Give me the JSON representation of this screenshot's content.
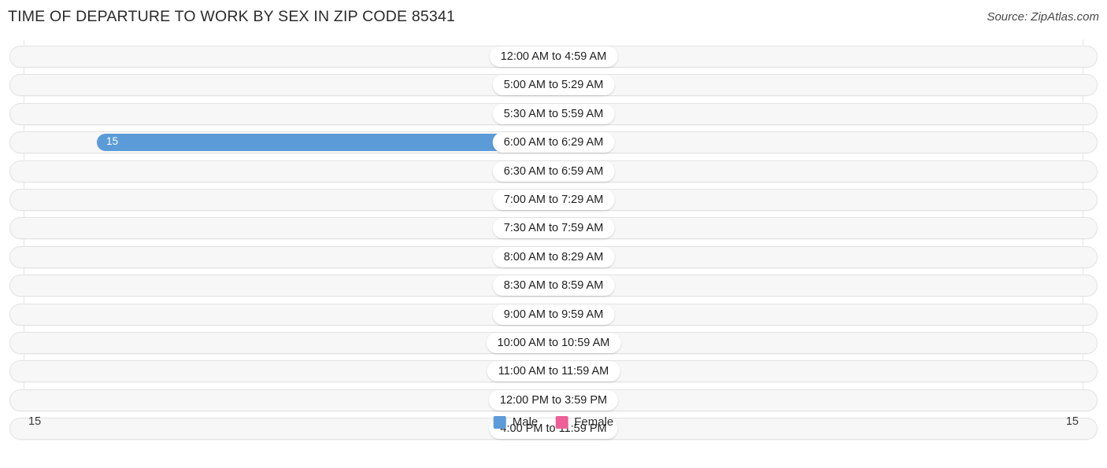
{
  "header": {
    "title": "TIME OF DEPARTURE TO WORK BY SEX IN ZIP CODE 85341",
    "source": "Source: ZipAtlas.com"
  },
  "legend": {
    "male_label": "Male",
    "female_label": "Female",
    "male_color": "#5b9bd8",
    "female_color": "#ef5f97"
  },
  "axis": {
    "left_max": "15",
    "right_max": "15"
  },
  "chart_data": {
    "type": "bar",
    "title": "TIME OF DEPARTURE TO WORK BY SEX IN ZIP CODE 85341",
    "subtitle": "Source: ZipAtlas.com",
    "orientation": "horizontal-diverging",
    "xlabel": "",
    "ylabel": "",
    "xlim": [
      15,
      15
    ],
    "grid": true,
    "legend_position": "bottom-center",
    "categories": [
      "12:00 AM to 4:59 AM",
      "5:00 AM to 5:29 AM",
      "5:30 AM to 5:59 AM",
      "6:00 AM to 6:29 AM",
      "6:30 AM to 6:59 AM",
      "7:00 AM to 7:29 AM",
      "7:30 AM to 7:59 AM",
      "8:00 AM to 8:29 AM",
      "8:30 AM to 8:59 AM",
      "9:00 AM to 9:59 AM",
      "10:00 AM to 10:59 AM",
      "11:00 AM to 11:59 AM",
      "12:00 PM to 3:59 PM",
      "4:00 PM to 11:59 PM"
    ],
    "series": [
      {
        "name": "Male",
        "color": "#5b9bd8",
        "values": [
          0,
          0,
          0,
          15,
          0,
          0,
          0,
          0,
          0,
          0,
          0,
          0,
          0,
          0
        ],
        "labels": [
          "0",
          "0",
          "0",
          "15",
          "0",
          "0",
          "0",
          "0",
          "0",
          "0",
          "0",
          "0",
          "0",
          "0"
        ]
      },
      {
        "name": "Female",
        "color": "#ef5f97",
        "values": [
          0,
          0,
          0,
          0,
          0,
          0,
          0,
          0,
          0,
          0,
          0,
          0,
          0,
          0
        ],
        "labels": [
          "0",
          "0",
          "0",
          "0",
          "0",
          "0",
          "0",
          "0",
          "0",
          "0",
          "0",
          "0",
          "0",
          "0"
        ]
      }
    ]
  }
}
